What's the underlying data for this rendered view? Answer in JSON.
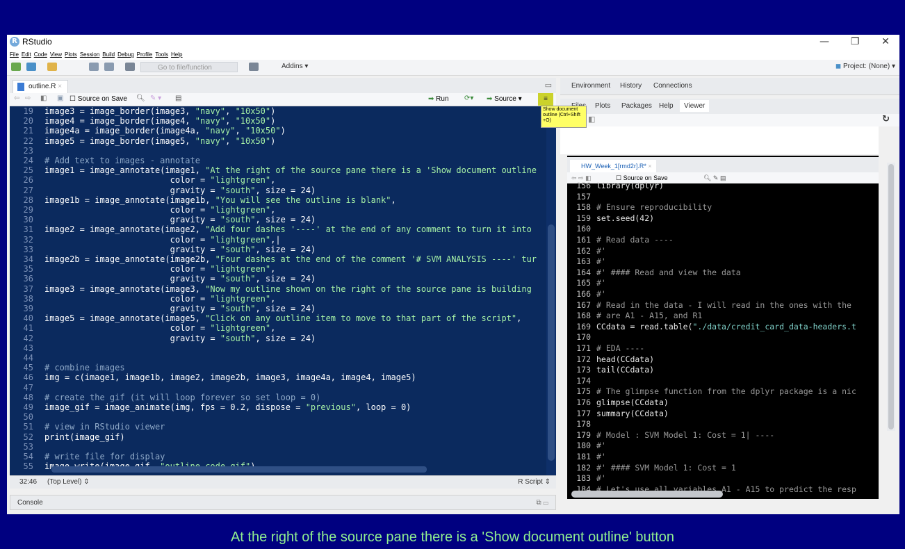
{
  "window": {
    "title": "RStudio",
    "logo": "R",
    "controls": {
      "minimize": "—",
      "restore": "❐",
      "close": "✕"
    }
  },
  "menu": [
    "File",
    "Edit",
    "Code",
    "View",
    "Plots",
    "Session",
    "Build",
    "Debug",
    "Profile",
    "Tools",
    "Help"
  ],
  "toolbar": {
    "goto_placeholder": "Go to file/function",
    "addins": "Addins",
    "project": "Project: (None)"
  },
  "source_pane": {
    "tab": "outline.R",
    "source_on_save": "Source on Save",
    "run": "Run",
    "source": "Source",
    "status_position": "32:46",
    "status_scope": "(Top Level)",
    "status_type": "R Script",
    "lines": [
      {
        "n": "19",
        "segs": [
          [
            "t",
            "image3 = image_border(image3, "
          ],
          [
            "s",
            "\"navy\""
          ],
          [
            "t",
            ", "
          ],
          [
            "s",
            "\"10x50\""
          ],
          [
            "t",
            ")"
          ]
        ]
      },
      {
        "n": "20",
        "segs": [
          [
            "t",
            "image4 = image_border(image4, "
          ],
          [
            "s",
            "\"navy\""
          ],
          [
            "t",
            ", "
          ],
          [
            "s",
            "\"10x50\""
          ],
          [
            "t",
            ")"
          ]
        ]
      },
      {
        "n": "21",
        "segs": [
          [
            "t",
            "image4a = image_border(image4a, "
          ],
          [
            "s",
            "\"navy\""
          ],
          [
            "t",
            ", "
          ],
          [
            "s",
            "\"10x50\""
          ],
          [
            "t",
            ")"
          ]
        ]
      },
      {
        "n": "22",
        "segs": [
          [
            "t",
            "image5 = image_border(image5, "
          ],
          [
            "s",
            "\"navy\""
          ],
          [
            "t",
            ", "
          ],
          [
            "s",
            "\"10x50\""
          ],
          [
            "t",
            ")"
          ]
        ]
      },
      {
        "n": "23",
        "segs": []
      },
      {
        "n": "24",
        "segs": [
          [
            "c",
            "# Add text to images - annotate"
          ]
        ]
      },
      {
        "n": "25",
        "segs": [
          [
            "t",
            "image1 = image_annotate(image1, "
          ],
          [
            "s",
            "\"At the right of the source pane there is a 'Show document outline"
          ]
        ]
      },
      {
        "n": "26",
        "segs": [
          [
            "t",
            "                         color = "
          ],
          [
            "s",
            "\"lightgreen\""
          ],
          [
            "t",
            ","
          ]
        ]
      },
      {
        "n": "27",
        "segs": [
          [
            "t",
            "                         gravity = "
          ],
          [
            "s",
            "\"south\""
          ],
          [
            "t",
            ", size = 24)"
          ]
        ]
      },
      {
        "n": "28",
        "segs": [
          [
            "t",
            "image1b = image_annotate(image1b, "
          ],
          [
            "s",
            "\"You will see the outline is blank\""
          ],
          [
            "t",
            ","
          ]
        ]
      },
      {
        "n": "29",
        "segs": [
          [
            "t",
            "                         color = "
          ],
          [
            "s",
            "\"lightgreen\""
          ],
          [
            "t",
            ","
          ]
        ]
      },
      {
        "n": "30",
        "segs": [
          [
            "t",
            "                         gravity = "
          ],
          [
            "s",
            "\"south\""
          ],
          [
            "t",
            ", size = 24)"
          ]
        ]
      },
      {
        "n": "31",
        "segs": [
          [
            "t",
            "image2 = image_annotate(image2, "
          ],
          [
            "s",
            "\"Add four dashes '----' at the end of any comment to turn it into"
          ]
        ]
      },
      {
        "n": "32",
        "segs": [
          [
            "t",
            "                         color = "
          ],
          [
            "s",
            "\"lightgreen\""
          ],
          [
            "t",
            ",|"
          ]
        ]
      },
      {
        "n": "33",
        "segs": [
          [
            "t",
            "                         gravity = "
          ],
          [
            "s",
            "\"south\""
          ],
          [
            "t",
            ", size = 24)"
          ]
        ]
      },
      {
        "n": "34",
        "segs": [
          [
            "t",
            "image2b = image_annotate(image2b, "
          ],
          [
            "s",
            "\"Four dashes at the end of the comment '# SVM ANALYSIS ----' tur"
          ]
        ]
      },
      {
        "n": "35",
        "segs": [
          [
            "t",
            "                         color = "
          ],
          [
            "s",
            "\"lightgreen\""
          ],
          [
            "t",
            ","
          ]
        ]
      },
      {
        "n": "36",
        "segs": [
          [
            "t",
            "                         gravity = "
          ],
          [
            "s",
            "\"south\""
          ],
          [
            "t",
            ", size = 24)"
          ]
        ]
      },
      {
        "n": "37",
        "segs": [
          [
            "t",
            "image3 = image_annotate(image3, "
          ],
          [
            "s",
            "\"Now my outline shown on the right of the source pane is building"
          ]
        ]
      },
      {
        "n": "38",
        "segs": [
          [
            "t",
            "                         color = "
          ],
          [
            "s",
            "\"lightgreen\""
          ],
          [
            "t",
            ","
          ]
        ]
      },
      {
        "n": "39",
        "segs": [
          [
            "t",
            "                         gravity = "
          ],
          [
            "s",
            "\"south\""
          ],
          [
            "t",
            ", size = 24)"
          ]
        ]
      },
      {
        "n": "40",
        "segs": [
          [
            "t",
            "image5 = image_annotate(image5, "
          ],
          [
            "s",
            "\"Click on any outline item to move to that part of the script\""
          ],
          [
            "t",
            ","
          ]
        ]
      },
      {
        "n": "41",
        "segs": [
          [
            "t",
            "                         color = "
          ],
          [
            "s",
            "\"lightgreen\""
          ],
          [
            "t",
            ","
          ]
        ]
      },
      {
        "n": "42",
        "segs": [
          [
            "t",
            "                         gravity = "
          ],
          [
            "s",
            "\"south\""
          ],
          [
            "t",
            ", size = 24)"
          ]
        ]
      },
      {
        "n": "43",
        "segs": []
      },
      {
        "n": "44",
        "segs": []
      },
      {
        "n": "45",
        "segs": [
          [
            "c",
            "# combine images"
          ]
        ]
      },
      {
        "n": "46",
        "segs": [
          [
            "t",
            "img = c(image1, image1b, image2, image2b, image3, image4a, image4, image5)"
          ]
        ]
      },
      {
        "n": "47",
        "segs": []
      },
      {
        "n": "48",
        "segs": [
          [
            "c",
            "# create the gif (it will loop forever so set loop = 0)"
          ]
        ]
      },
      {
        "n": "49",
        "segs": [
          [
            "t",
            "image_gif = image_animate(img, fps = 0.2, dispose = "
          ],
          [
            "s",
            "\"previous\""
          ],
          [
            "t",
            ", loop = 0)"
          ]
        ]
      },
      {
        "n": "50",
        "segs": []
      },
      {
        "n": "51",
        "segs": [
          [
            "c",
            "# view in RStudio viewer"
          ]
        ]
      },
      {
        "n": "52",
        "segs": [
          [
            "t",
            "print(image_gif)"
          ]
        ]
      },
      {
        "n": "53",
        "segs": []
      },
      {
        "n": "54",
        "segs": [
          [
            "c",
            "# write file for display"
          ]
        ]
      },
      {
        "n": "55",
        "segs": [
          [
            "t",
            "image_write(image_gif, "
          ],
          [
            "s",
            "\"outline_code.gif\""
          ],
          [
            "t",
            ")"
          ]
        ]
      }
    ]
  },
  "console": {
    "label": "Console"
  },
  "right_pane": {
    "top_tabs": [
      "Environment",
      "History",
      "Connections"
    ],
    "bottom_tabs": [
      "Files",
      "Plots",
      "Packages",
      "Help",
      "Viewer"
    ],
    "tooltip": "Show document outline (Ctrl+Shift +O)",
    "inner_tab": "HW_Week_1[rmd2r].R*",
    "inner_source_on_save": "Source on Save",
    "lines": [
      {
        "n": "156",
        "segs": [
          [
            "t",
            "library(dplyr)"
          ]
        ]
      },
      {
        "n": "157",
        "segs": []
      },
      {
        "n": "158",
        "segs": [
          [
            "c",
            "# Ensure reproducibility"
          ]
        ]
      },
      {
        "n": "159",
        "segs": [
          [
            "t",
            "set.seed(42)"
          ]
        ]
      },
      {
        "n": "160",
        "segs": []
      },
      {
        "n": "161",
        "segs": [
          [
            "c",
            "# Read data ----"
          ]
        ]
      },
      {
        "n": "162",
        "segs": [
          [
            "c",
            "#'"
          ]
        ]
      },
      {
        "n": "163",
        "segs": [
          [
            "c",
            "#'"
          ]
        ]
      },
      {
        "n": "164",
        "segs": [
          [
            "c",
            "#' #### Read and view the data"
          ]
        ]
      },
      {
        "n": "165",
        "segs": [
          [
            "c",
            "#'"
          ]
        ]
      },
      {
        "n": "166",
        "segs": [
          [
            "c",
            "#'"
          ]
        ]
      },
      {
        "n": "167",
        "segs": [
          [
            "c",
            "# Read in the data - I will read in the ones with the"
          ]
        ]
      },
      {
        "n": "168",
        "segs": [
          [
            "c",
            "# are A1 - A15, and R1"
          ]
        ]
      },
      {
        "n": "169",
        "segs": [
          [
            "t",
            "CCdata = read.table("
          ],
          [
            "s",
            "\"./data/credit_card_data-headers.t"
          ]
        ]
      },
      {
        "n": "170",
        "segs": []
      },
      {
        "n": "171",
        "segs": [
          [
            "c",
            "# EDA ----"
          ]
        ]
      },
      {
        "n": "172",
        "segs": [
          [
            "t",
            "head(CCdata)"
          ]
        ]
      },
      {
        "n": "173",
        "segs": [
          [
            "t",
            "tail(CCdata)"
          ]
        ]
      },
      {
        "n": "174",
        "segs": []
      },
      {
        "n": "175",
        "segs": [
          [
            "c",
            "# The glimpse function from the dplyr package is a nic"
          ]
        ]
      },
      {
        "n": "176",
        "segs": [
          [
            "t",
            "glimpse(CCdata)"
          ]
        ]
      },
      {
        "n": "177",
        "segs": [
          [
            "t",
            "summary(CCdata)"
          ]
        ]
      },
      {
        "n": "178",
        "segs": []
      },
      {
        "n": "179",
        "segs": [
          [
            "c",
            "# Model : SVM Model 1: Cost = 1| ----"
          ]
        ]
      },
      {
        "n": "180",
        "segs": [
          [
            "c",
            "#'"
          ]
        ]
      },
      {
        "n": "181",
        "segs": [
          [
            "c",
            "#'"
          ]
        ]
      },
      {
        "n": "182",
        "segs": [
          [
            "c",
            "#' #### SVM Model 1: Cost = 1"
          ]
        ]
      },
      {
        "n": "183",
        "segs": [
          [
            "c",
            "#'"
          ]
        ]
      },
      {
        "n": "184",
        "segs": [
          [
            "c",
            "# Let's use all variables A1 - A15 to predict the resp"
          ]
        ]
      }
    ]
  },
  "caption": "At the right of the source pane there is a 'Show document outline' button"
}
